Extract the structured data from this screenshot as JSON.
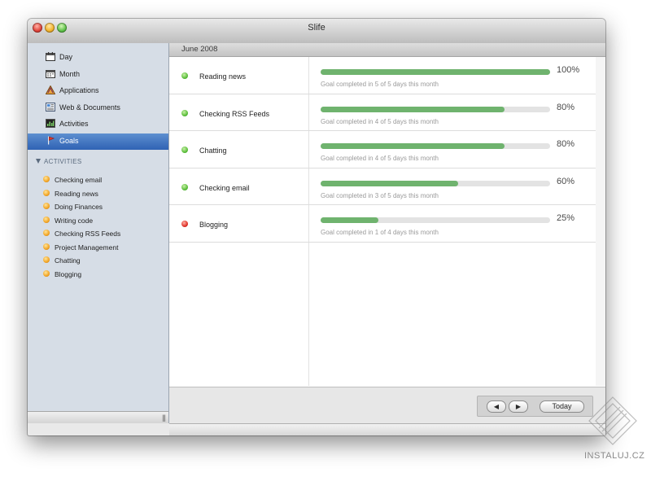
{
  "window": {
    "title": "Slife"
  },
  "sidebar": {
    "nav": [
      {
        "label": "Day",
        "icon": "calendar-icon",
        "active": false
      },
      {
        "label": "Month",
        "icon": "calendar-month-icon",
        "active": false
      },
      {
        "label": "Applications",
        "icon": "applications-icon",
        "active": false
      },
      {
        "label": "Web & Documents",
        "icon": "web-documents-icon",
        "active": false
      },
      {
        "label": "Activities",
        "icon": "activities-icon",
        "active": false
      },
      {
        "label": "Goals",
        "icon": "goals-flag-icon",
        "active": true
      }
    ],
    "section_title": "ACTIVITIES",
    "activities": [
      "Checking email",
      "Reading news",
      "Doing Finances",
      "Writing code",
      "Checking RSS Feeds",
      "Project Management",
      "Chatting",
      "Blogging"
    ],
    "grip": "|||"
  },
  "content": {
    "month": "June 2008",
    "goals": [
      {
        "name": "Reading news",
        "percent_label": "100%",
        "progress": 1.0,
        "caption": "Goal completed in 5 of 5 days this month",
        "status": "green"
      },
      {
        "name": "Checking RSS Feeds",
        "percent_label": "80%",
        "progress": 0.8,
        "caption": "Goal completed in 4 of 5 days this month",
        "status": "green"
      },
      {
        "name": "Chatting",
        "percent_label": "80%",
        "progress": 0.8,
        "caption": "Goal completed in 4 of 5 days this month",
        "status": "green"
      },
      {
        "name": "Checking email",
        "percent_label": "60%",
        "progress": 0.6,
        "caption": "Goal completed in 3 of 5 days this month",
        "status": "green"
      },
      {
        "name": "Blogging",
        "percent_label": "25%",
        "progress": 0.25,
        "caption": "Goal completed in 1 of 4 days this month",
        "status": "red"
      }
    ]
  },
  "footer": {
    "prev": "◀",
    "next": "▶",
    "today": "Today"
  },
  "watermark": {
    "text": "INSTALUJ.CZ"
  },
  "colors": {
    "progress_fill": "#6fb36e",
    "selection": "#2f62b4",
    "status_green": "#5cbf3c",
    "status_red": "#e0342b",
    "activity_dot": "#f2a424"
  }
}
